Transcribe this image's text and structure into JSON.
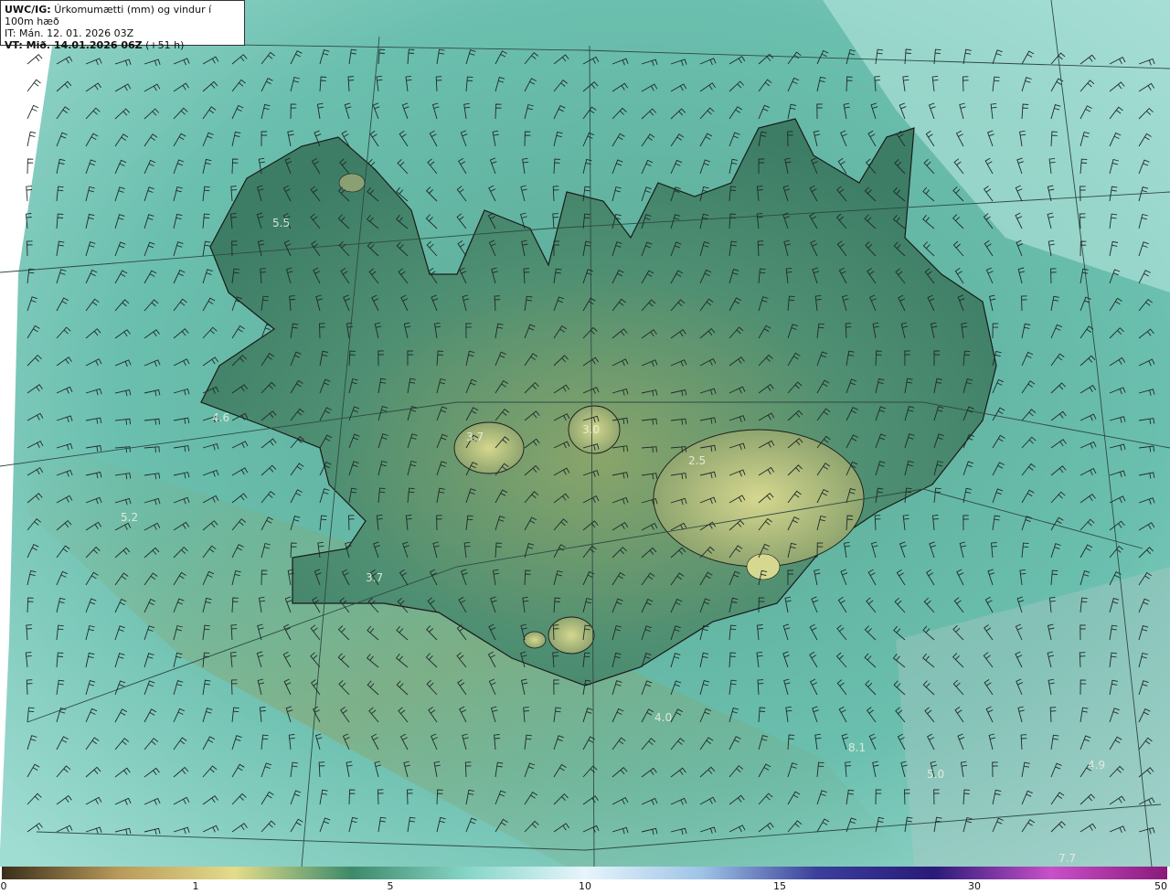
{
  "header": {
    "product": "UWC/IG:",
    "title": "Úrkomumætti (mm) og vindur í 100m hæð",
    "issue_time": "IT: Mán. 12. 01. 2026 03Z",
    "valid_prefix": "VT: Mið. 14.01.2026 06Z",
    "lead": "(+51 h)"
  },
  "map_labels": [
    {
      "id": "v1",
      "text": "5.5"
    },
    {
      "id": "v2",
      "text": "4.6"
    },
    {
      "id": "v3",
      "text": "5.2"
    },
    {
      "id": "v4",
      "text": "3.7"
    },
    {
      "id": "v5",
      "text": "3.0"
    },
    {
      "id": "v6",
      "text": "3.7"
    },
    {
      "id": "v7",
      "text": "2.5"
    },
    {
      "id": "v8",
      "text": "4.0"
    },
    {
      "id": "v9",
      "text": "8.1"
    },
    {
      "id": "v10",
      "text": "5.0"
    },
    {
      "id": "v11",
      "text": "4.9"
    },
    {
      "id": "v12",
      "text": "7.7"
    }
  ],
  "legend": {
    "ticks": [
      "0",
      "1",
      "5",
      "10",
      "15",
      "30",
      "50"
    ],
    "colors": [
      "#3a2e1a",
      "#b89a5a",
      "#e3dc8a",
      "#3d8a6a",
      "#86d6c8",
      "#e6f5fb",
      "#9ec4e6",
      "#3a3f9a",
      "#2a1a7a",
      "#c850c8",
      "#8a1a7a"
    ]
  }
}
